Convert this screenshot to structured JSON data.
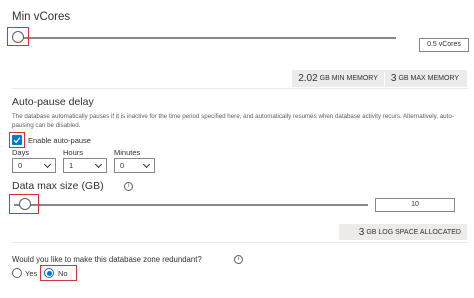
{
  "vcores": {
    "title": "Min vCores",
    "value": "0.5 vCores",
    "slider_fraction": 0.0
  },
  "memory": {
    "min_value": "2.02",
    "min_unit": "GB MIN MEMORY",
    "max_value": "3",
    "max_unit": "GB MAX MEMORY"
  },
  "autopause": {
    "title": "Auto-pause delay",
    "description": "The database automatically pauses if it is inactive for the time period specified here, and automatically resumes when database activity recurs. Alternatively, auto-pausing can be disabled.",
    "enable_label": "Enable auto-pause",
    "enabled": true,
    "days_label": "Days",
    "days_value": "0",
    "hours_label": "Hours",
    "hours_value": "1",
    "minutes_label": "Minutes",
    "minutes_value": "0"
  },
  "datasize": {
    "title": "Data max size (GB)",
    "info_glyph": "i",
    "value": "10",
    "slider_fraction": 0.0
  },
  "logspace": {
    "value": "3",
    "unit": "GB LOG SPACE ALLOCATED"
  },
  "zone": {
    "question": "Would you like to make this database zone redundant?",
    "info_glyph": "i",
    "yes_label": "Yes",
    "no_label": "No",
    "selected": "No"
  },
  "colors": {
    "accent": "#0078d4",
    "highlight": "#d13438",
    "infobar": "#edebe9"
  }
}
